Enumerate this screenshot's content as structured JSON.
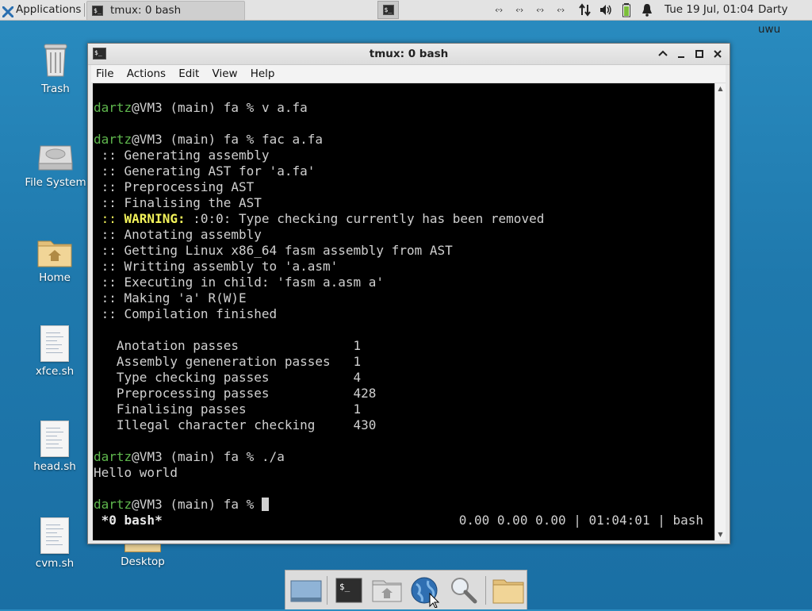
{
  "top_panel": {
    "applications_label": "Applications",
    "task_title": "tmux: 0 bash",
    "clock": "Tue 19 Jul, 01:04",
    "user": "Darty uwu",
    "net_glyph": "‹·›"
  },
  "desktop_icons": [
    {
      "label": "Trash"
    },
    {
      "label": "File System"
    },
    {
      "label": "Home"
    },
    {
      "label": "xfce.sh"
    },
    {
      "label": "head.sh"
    },
    {
      "label": "cvm.sh"
    },
    {
      "label": "Desktop"
    }
  ],
  "window": {
    "title": "tmux: 0 bash",
    "menu": [
      "File",
      "Actions",
      "Edit",
      "View",
      "Help"
    ]
  },
  "terminal": {
    "prompt_user": "dartz",
    "prompt_rest": "@VM3 (main) fa % ",
    "cmd1": "v a.fa",
    "cmd2": "fac a.fa",
    "cmd3": "./a",
    "log": {
      "l1": " :: Generating assembly",
      "l2": " :: Generating AST for 'a.fa'",
      "l3": " :: Preprocessing AST",
      "l4": " :: Finalising the AST",
      "warn_prefix": " :: ",
      "warn_label": "WARNING:",
      "warn_msg": " :0:0: Type checking currently has been removed",
      "l6": " :: Anotating assembly",
      "l7": " :: Getting Linux x86_64 fasm assembly from AST",
      "l8": " :: Writting assembly to 'a.asm'",
      "l9": " :: Executing in child: 'fasm a.asm a'",
      "l10": " :: Making 'a' R(W)E",
      "l11": " :: Compilation finished"
    },
    "stats": {
      "s1": "   Anotation passes               1",
      "s2": "   Assembly geneneration passes   1",
      "s3": "   Type checking passes           4",
      "s4": "   Preprocessing passes           428",
      "s5": "   Finalising passes              1",
      "s6": "   Illegal character checking     430"
    },
    "output": "Hello world",
    "status_left": " *0 bash*",
    "status_right": "0.00 0.00 0.00 | 01:04:01 | bash"
  }
}
